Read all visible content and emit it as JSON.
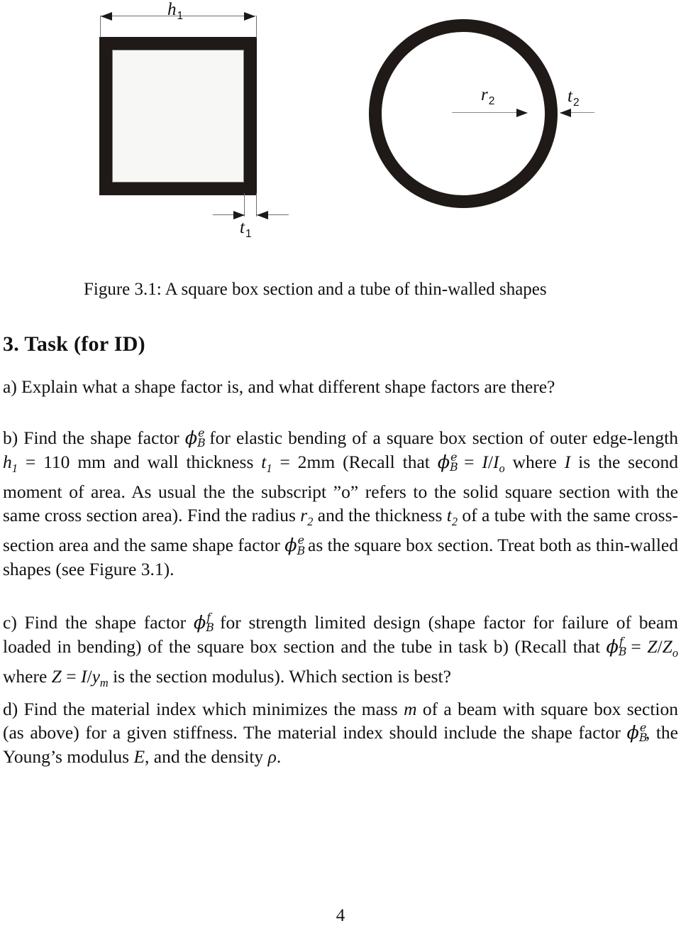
{
  "figure": {
    "square": {
      "width_label": "h",
      "width_label_sub": "1",
      "thickness_label": "t",
      "thickness_label_sub": "1"
    },
    "tube": {
      "radius_label": "r",
      "radius_label_sub": "2",
      "thickness_label": "t",
      "thickness_label_sub": "2"
    },
    "caption": "Figure 3.1: A square box section and a tube of thin-walled shapes"
  },
  "section": {
    "heading": "3. Task (for ID)"
  },
  "tasks": {
    "a": {
      "text": "a) Explain what a shape factor is, and what different shape factors are there?"
    },
    "b": {
      "seg1": "b) Find the shape factor ",
      "phi1_base": "ϕ",
      "phi1_sup": "e",
      "phi1_sub": "B",
      "seg2": " for elastic bending of a square box section of outer edge-length ",
      "h1": "h",
      "h1_sub": "1",
      "seg3": " = 110 mm and wall thickness ",
      "t1": "t",
      "t1_sub": "1",
      "seg4": " = 2mm (Recall that ",
      "phi2_base": "ϕ",
      "phi2_sup": "e",
      "phi2_sub": "B",
      "seg5": " = ",
      "I": "I",
      "slash1": "/",
      "Io": "I",
      "Io_sub": "o",
      "seg6": " where ",
      "I2": "I",
      "seg7": " is the second moment of area. As usual the the subscript ”o” refers to the solid square section with the same cross section area). Find the radius ",
      "r2": "r",
      "r2_sub": "2",
      "seg8": " and the thickness ",
      "t2": "t",
      "t2_sub": "2",
      "seg9": " of a tube with the same cross-section area and the same shape factor ",
      "phi3_base": "ϕ",
      "phi3_sup": "e",
      "phi3_sub": "B",
      "seg10": " as the square box section. Treat both as thin-walled shapes (see Figure 3.1)."
    },
    "c": {
      "seg1": "c) Find the shape factor ",
      "phi1_base": "ϕ",
      "phi1_sup": "f",
      "phi1_sub": "B",
      "seg2": " for strength limited design (shape factor for failure of beam loaded in bending) of the square box section and the tube in task b) (Recall that ",
      "phi2_base": "ϕ",
      "phi2_sup": "f",
      "phi2_sub": "B",
      "seg3": " = ",
      "Z": "Z",
      "slash1": "/",
      "Zo": "Z",
      "Zo_sub": "o",
      "seg4": " where ",
      "Z2": "Z",
      "seg5": " = ",
      "I": "I",
      "slash2": "/",
      "y": "y",
      "y_sub": "m",
      "seg6": " is the section modulus). Which section is best?"
    },
    "d": {
      "seg1": "d) Find the material index which minimizes the mass ",
      "m": "m",
      "seg2": " of a beam with square box section (as above) for a given stiffness. The material index should include the shape factor ",
      "phi1_base": "ϕ",
      "phi1_sup": "e",
      "phi1_sub": "B",
      "seg3": ", the Young’s modulus ",
      "E": "E",
      "seg4": ", and the density ",
      "rho": "ρ",
      "seg5": "."
    }
  },
  "footer": {
    "page_number": "4"
  },
  "colors": {
    "ink": "#1f1a17",
    "page": "#ffffff",
    "dimension_line": "#6e6e6e",
    "inner_fill": "#f7f7f5"
  }
}
